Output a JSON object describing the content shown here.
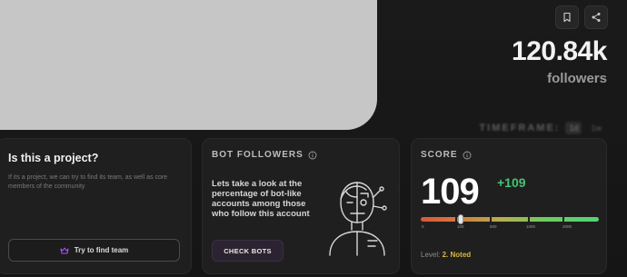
{
  "header": {
    "followers_count": "120.84k",
    "followers_label": "followers",
    "timeframe_label": "TIMEFRAME:",
    "timeframe_options": [
      "1d",
      "1w"
    ]
  },
  "project_card": {
    "title": "Is this a project?",
    "description": "If its a project, we can try to find its team, as well as core members of the community",
    "button_label": "Try to find team"
  },
  "bots_card": {
    "title": "BOT FOLLOWERS",
    "description": "Lets take a look at the percentage of bot-like accounts among those who follow this account",
    "button_label": "CHECK BOTS"
  },
  "score_card": {
    "title": "SCORE",
    "value": "109",
    "delta": "+109",
    "ticks": [
      "0",
      "100",
      "500",
      "1000",
      "2000"
    ],
    "level_prefix": "Level:",
    "level_value": "2. Noted",
    "progress_value": 109
  },
  "colors": {
    "background": "#161616",
    "card": "#1f1f1f",
    "positive": "#46c473",
    "level": "#d9b83a",
    "accent_purple": "#a855f7"
  }
}
